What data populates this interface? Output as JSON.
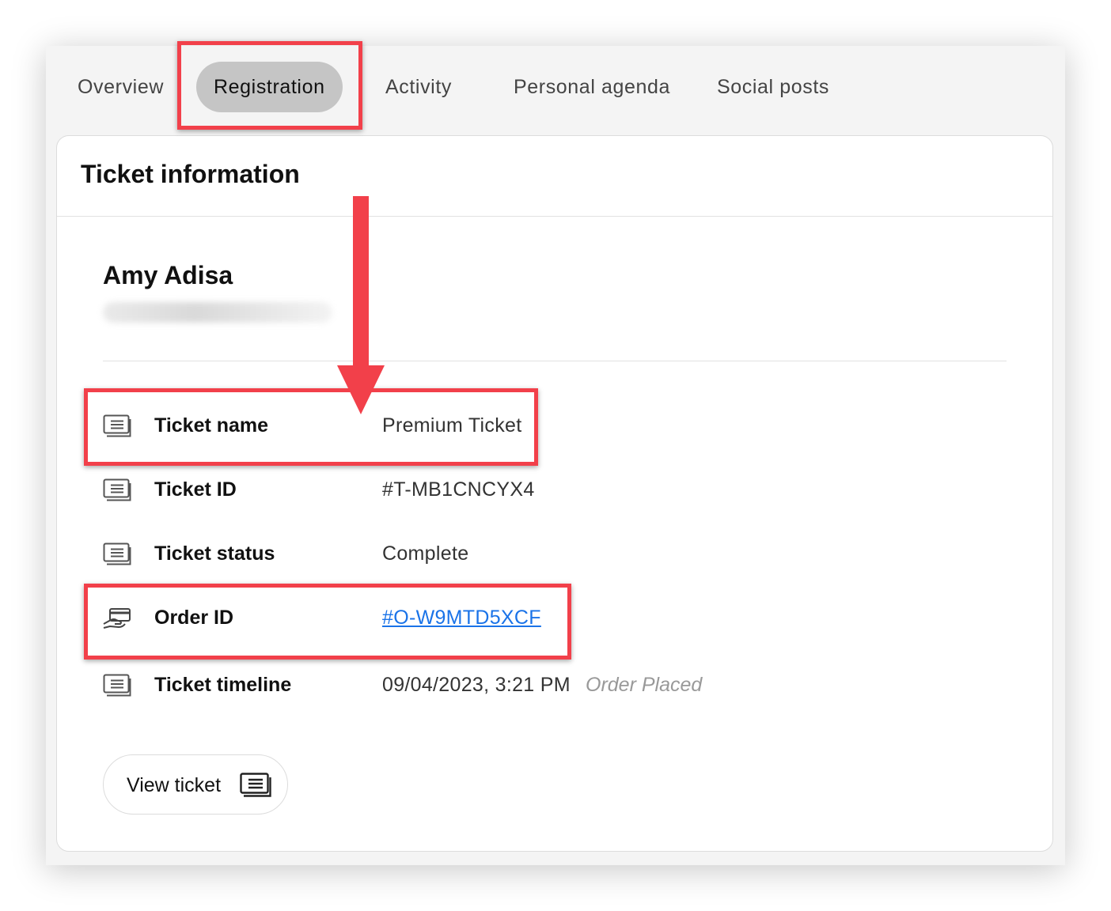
{
  "tabs": [
    {
      "label": "Overview"
    },
    {
      "label": "Registration"
    },
    {
      "label": "Activity"
    },
    {
      "label": "Personal agenda"
    },
    {
      "label": "Social posts"
    }
  ],
  "active_tab": "Registration",
  "card": {
    "title": "Ticket information"
  },
  "attendee": {
    "name": "Amy Adisa"
  },
  "rows": [
    {
      "icon": "ticket-icon",
      "label": "Ticket name",
      "value": "Premium Ticket"
    },
    {
      "icon": "ticket-icon",
      "label": "Ticket ID",
      "value": "#T-MB1CNCYX4"
    },
    {
      "icon": "ticket-icon",
      "label": "Ticket status",
      "value": "Complete"
    },
    {
      "icon": "payment-card-hand-icon",
      "label": "Order ID",
      "value": "#O-W9MTD5XCF"
    },
    {
      "icon": "ticket-icon",
      "label": "Ticket timeline",
      "value": "09/04/2023, 3:21 PM",
      "note": "Order Placed"
    }
  ],
  "view_ticket": {
    "label": "View ticket",
    "icon": "ticket-icon"
  },
  "colors": {
    "highlight": "#f2404a",
    "link": "#1a73e8",
    "active_tab_bg": "#c5c5c5"
  }
}
